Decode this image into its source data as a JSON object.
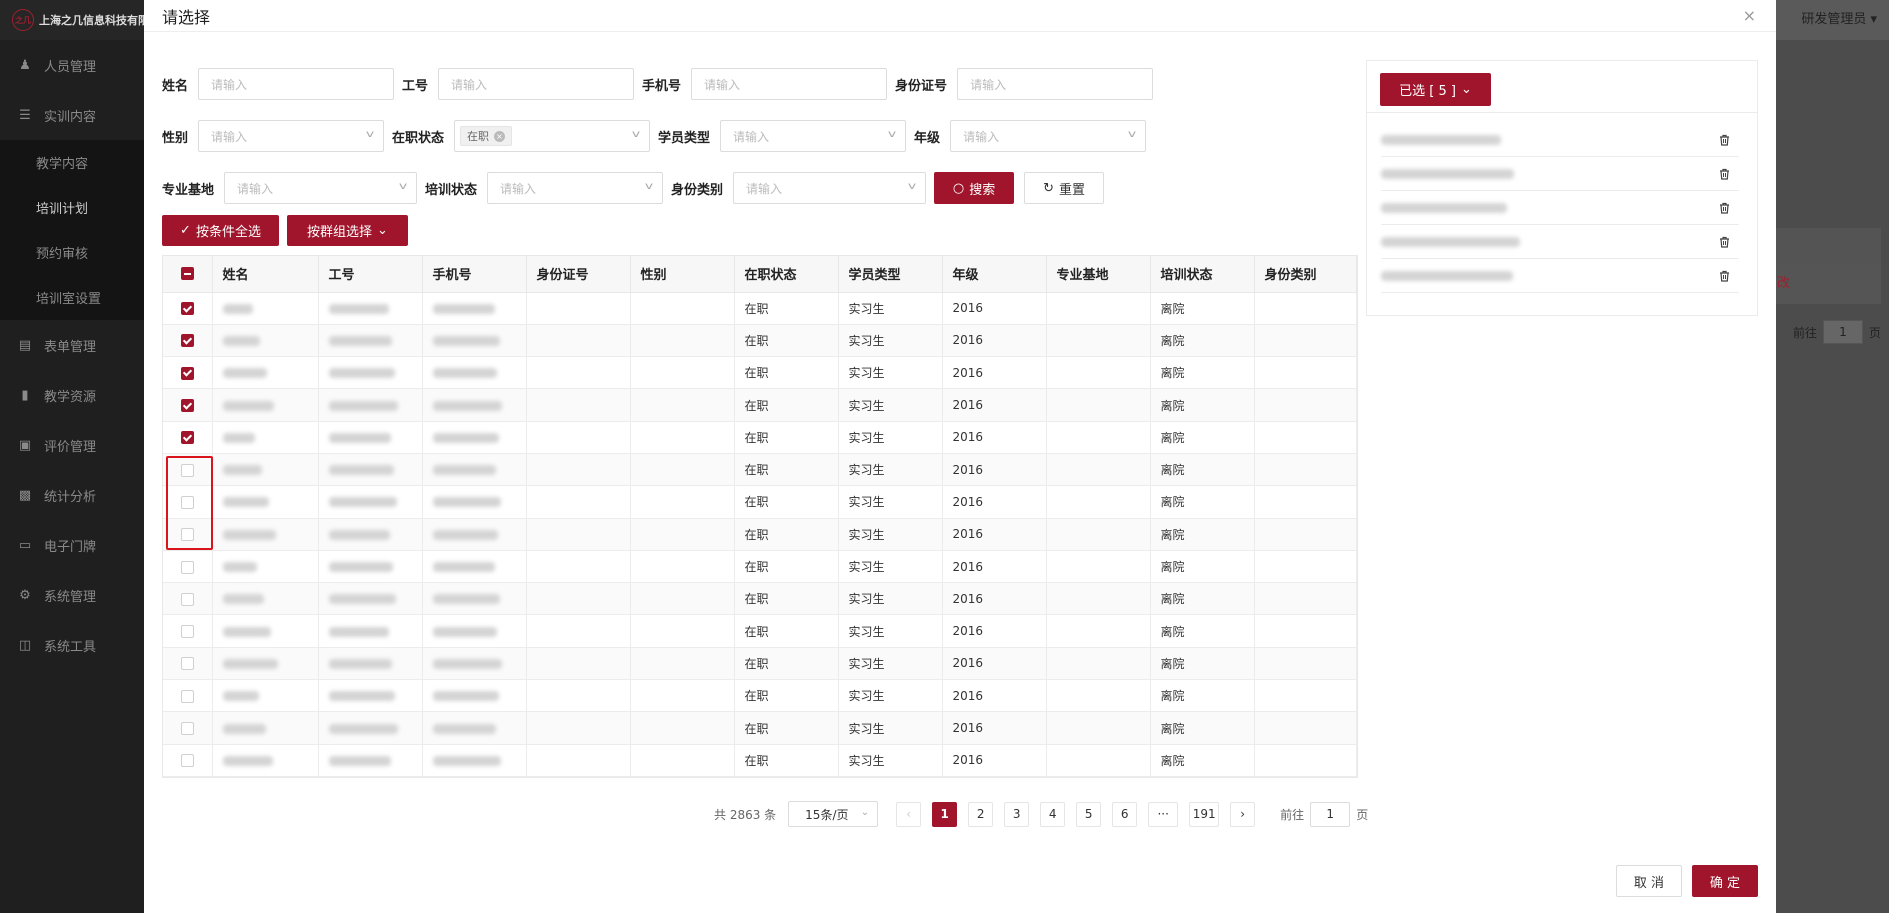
{
  "app": {
    "logo_text": "上海之几信息科技有限",
    "logo_mark": "之几",
    "user_name": "研发管理员",
    "menu": [
      {
        "label": "人员管理",
        "icon": "users-icon"
      },
      {
        "label": "实训内容",
        "icon": "content-icon"
      },
      {
        "label": "表单管理",
        "icon": "form-icon"
      },
      {
        "label": "教学资源",
        "icon": "resource-icon"
      },
      {
        "label": "评价管理",
        "icon": "evaluation-icon"
      },
      {
        "label": "统计分析",
        "icon": "chart-icon"
      },
      {
        "label": "电子门牌",
        "icon": "monitor-icon"
      },
      {
        "label": "系统管理",
        "icon": "gear-icon"
      },
      {
        "label": "系统工具",
        "icon": "toolbox-icon"
      }
    ],
    "submenu": [
      {
        "label": "教学内容"
      },
      {
        "label": "培训计划"
      },
      {
        "label": "预约审核"
      },
      {
        "label": "培训室设置"
      }
    ],
    "bg_row_text": "改",
    "bg_pager": {
      "goto": "前往",
      "page": "1",
      "unit": "页"
    }
  },
  "dialog": {
    "title": "请选择",
    "close_glyph": "×",
    "filters": {
      "name": {
        "label": "姓名",
        "placeholder": "请输入"
      },
      "job_no": {
        "label": "工号",
        "placeholder": "请输入"
      },
      "phone": {
        "label": "手机号",
        "placeholder": "请输入"
      },
      "id_no": {
        "label": "身份证号",
        "placeholder": "请输入"
      },
      "gender": {
        "label": "性别",
        "placeholder": "请输入"
      },
      "status": {
        "label": "在职状态",
        "tag": "在职"
      },
      "student_type": {
        "label": "学员类型",
        "placeholder": "请输入"
      },
      "grade": {
        "label": "年级",
        "placeholder": "请输入"
      },
      "base": {
        "label": "专业基地",
        "placeholder": "请输入"
      },
      "train_status": {
        "label": "培训状态",
        "placeholder": "请输入"
      },
      "id_type": {
        "label": "身份类别",
        "placeholder": "请输入"
      }
    },
    "search_label": "搜索",
    "reset_label": "重置",
    "select_all_label": "按条件全选",
    "group_select_label": "按群组选择",
    "columns": [
      "姓名",
      "工号",
      "手机号",
      "身份证号",
      "性别",
      "在职状态",
      "学员类型",
      "年级",
      "专业基地",
      "培训状态",
      "身份类别"
    ],
    "rows": [
      {
        "checked": true,
        "status": "在职",
        "type": "实习生",
        "grade": "2016",
        "train": "离院"
      },
      {
        "checked": true,
        "status": "在职",
        "type": "实习生",
        "grade": "2016",
        "train": "离院"
      },
      {
        "checked": true,
        "status": "在职",
        "type": "实习生",
        "grade": "2016",
        "train": "离院"
      },
      {
        "checked": true,
        "status": "在职",
        "type": "实习生",
        "grade": "2016",
        "train": "离院"
      },
      {
        "checked": true,
        "status": "在职",
        "type": "实习生",
        "grade": "2016",
        "train": "离院"
      },
      {
        "checked": false,
        "status": "在职",
        "type": "实习生",
        "grade": "2016",
        "train": "离院"
      },
      {
        "checked": false,
        "status": "在职",
        "type": "实习生",
        "grade": "2016",
        "train": "离院"
      },
      {
        "checked": false,
        "status": "在职",
        "type": "实习生",
        "grade": "2016",
        "train": "离院"
      },
      {
        "checked": false,
        "status": "在职",
        "type": "实习生",
        "grade": "2016",
        "train": "离院"
      },
      {
        "checked": false,
        "status": "在职",
        "type": "实习生",
        "grade": "2016",
        "train": "离院"
      },
      {
        "checked": false,
        "status": "在职",
        "type": "实习生",
        "grade": "2016",
        "train": "离院"
      },
      {
        "checked": false,
        "status": "在职",
        "type": "实习生",
        "grade": "2016",
        "train": "离院"
      },
      {
        "checked": false,
        "status": "在职",
        "type": "实习生",
        "grade": "2016",
        "train": "离院"
      },
      {
        "checked": false,
        "status": "在职",
        "type": "实习生",
        "grade": "2016",
        "train": "离院"
      },
      {
        "checked": false,
        "status": "在职",
        "type": "实习生",
        "grade": "2016",
        "train": "离院"
      }
    ],
    "pagination": {
      "total": "共 2863 条",
      "page_size": "15条/页",
      "prev": "‹",
      "pages": [
        "1",
        "2",
        "3",
        "4",
        "5",
        "6",
        "···",
        "191"
      ],
      "next": "›",
      "active": "1",
      "goto_label": "前往",
      "goto_value": "1",
      "goto_unit": "页"
    },
    "selected": {
      "label": "已选 [ 5 ]",
      "count": 5
    },
    "cancel_label": "取 消",
    "confirm_label": "确 定"
  },
  "colors": {
    "primary": "#a0152b",
    "highlight": "#d9141c"
  }
}
